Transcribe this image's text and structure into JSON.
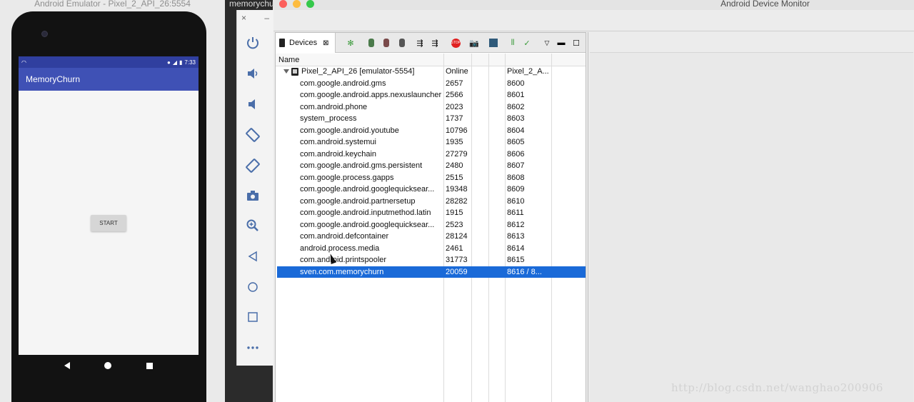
{
  "emulator": {
    "window_title": "Android Emulator - Pixel_2_API_26:5554",
    "status_time": "7:33",
    "app_title": "MemoryChurn",
    "start_button": "START"
  },
  "ide": {
    "tab_label": "memorychu"
  },
  "control_panel": {
    "close": "×",
    "minimize": "–",
    "buttons": [
      "power-icon",
      "volume-up-icon",
      "volume-down-icon",
      "rotate-left-icon",
      "rotate-right-icon",
      "camera-icon",
      "zoom-icon",
      "back-icon",
      "home-icon",
      "overview-icon",
      "more-icon"
    ]
  },
  "monitor": {
    "window_title": "Android Device Monitor",
    "devices_tab": "Devices",
    "table": {
      "header_name": "Name",
      "device": {
        "name": "Pixel_2_API_26 [emulator-5554]",
        "status": "Online",
        "port": "Pixel_2_A..."
      },
      "processes": [
        {
          "name": "com.google.android.gms",
          "pid": "2657",
          "port": "8600"
        },
        {
          "name": "com.google.android.apps.nexuslauncher",
          "pid": "2566",
          "port": "8601"
        },
        {
          "name": "com.android.phone",
          "pid": "2023",
          "port": "8602"
        },
        {
          "name": "system_process",
          "pid": "1737",
          "port": "8603"
        },
        {
          "name": "com.google.android.youtube",
          "pid": "10796",
          "port": "8604"
        },
        {
          "name": "com.android.systemui",
          "pid": "1935",
          "port": "8605"
        },
        {
          "name": "com.android.keychain",
          "pid": "27279",
          "port": "8606"
        },
        {
          "name": "com.google.android.gms.persistent",
          "pid": "2480",
          "port": "8607"
        },
        {
          "name": "com.google.process.gapps",
          "pid": "2515",
          "port": "8608"
        },
        {
          "name": "com.google.android.googlequicksear...",
          "pid": "19348",
          "port": "8609"
        },
        {
          "name": "com.google.android.partnersetup",
          "pid": "28282",
          "port": "8610"
        },
        {
          "name": "com.google.android.inputmethod.latin",
          "pid": "1915",
          "port": "8611"
        },
        {
          "name": "com.google.android.googlequicksear...",
          "pid": "2523",
          "port": "8612"
        },
        {
          "name": "com.android.defcontainer",
          "pid": "28124",
          "port": "8613"
        },
        {
          "name": "android.process.media",
          "pid": "2461",
          "port": "8614"
        },
        {
          "name": "com.android.printspooler",
          "pid": "31773",
          "port": "8615"
        },
        {
          "name": "sven.com.memorychurn",
          "pid": "20059",
          "port": "8616 / 8..."
        }
      ]
    }
  },
  "watermark": "http://blog.csdn.net/wanghao200906",
  "colors": {
    "appbar": "#3f51b5",
    "statusbar": "#303f9f",
    "selection": "#1a6ad8"
  }
}
